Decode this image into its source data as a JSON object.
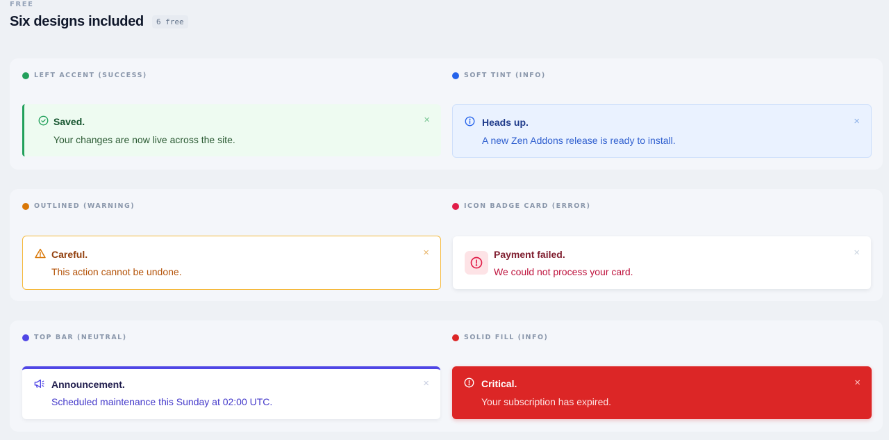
{
  "header": {
    "eyebrow": "FREE",
    "title": "Six designs included",
    "count_badge": "6 free"
  },
  "colors": {
    "success": "#22a05b",
    "info": "#2563eb",
    "warning": "#d97706",
    "error": "#e11d48",
    "neutral": "#4f46e5",
    "solid": "#dc2626"
  },
  "demos": {
    "success": {
      "label": "LEFT ACCENT (SUCCESS)",
      "icon": "check-circle-icon",
      "title": "Saved.",
      "message": "Your changes are now live across the site.",
      "close": "×"
    },
    "info": {
      "label": "SOFT TINT (INFO)",
      "icon": "info-circle-icon",
      "title": "Heads up.",
      "message": "A new Zen Addons release is ready to install.",
      "close": "×"
    },
    "warning": {
      "label": "OUTLINED (WARNING)",
      "icon": "warning-triangle-icon",
      "title": "Careful.",
      "message": "This action cannot be undone.",
      "close": "×"
    },
    "error": {
      "label": "ICON BADGE CARD (ERROR)",
      "icon": "alert-circle-icon",
      "title": "Payment failed.",
      "message": "We could not process your card.",
      "close": "×"
    },
    "neutral": {
      "label": "TOP BAR (NEUTRAL)",
      "icon": "megaphone-icon",
      "title": "Announcement.",
      "message": "Scheduled maintenance this Sunday at 02:00 UTC.",
      "close": "×"
    },
    "solid": {
      "label": "SOLID FILL (INFO)",
      "icon": "alert-circle-icon",
      "title": "Critical.",
      "message": "Your subscription has expired.",
      "close": "×"
    }
  }
}
